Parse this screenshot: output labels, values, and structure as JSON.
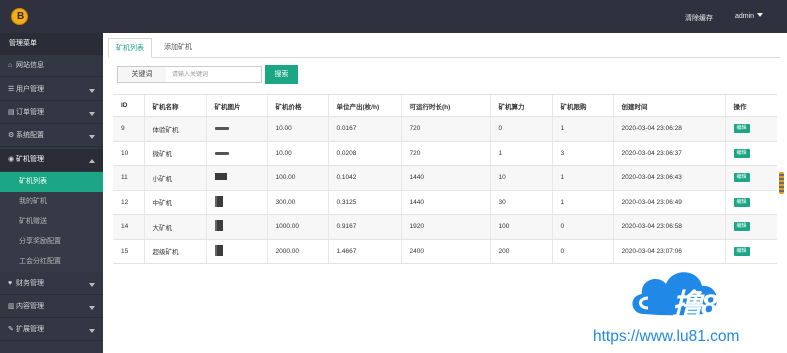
{
  "header": {
    "logo_letter": "B",
    "clear_cache": "清除缓存",
    "admin": "admin"
  },
  "sidebar": {
    "title": "管理菜单",
    "items": [
      {
        "icon": "home-icon",
        "glyph": "⌂",
        "label": "网站信息"
      },
      {
        "icon": "user-icon",
        "glyph": "☰",
        "label": "用户管理"
      },
      {
        "icon": "order-icon",
        "glyph": "▤",
        "label": "订单管理"
      },
      {
        "icon": "settings-icon",
        "glyph": "⚙",
        "label": "系统配置"
      },
      {
        "icon": "miner-icon",
        "glyph": "◉",
        "label": "矿机管理"
      },
      {
        "icon": "finance-icon",
        "glyph": "♥",
        "label": "财务管理"
      },
      {
        "icon": "content-icon",
        "glyph": "▥",
        "label": "内容管理"
      },
      {
        "icon": "extension-icon",
        "glyph": "✎",
        "label": "扩展管理"
      }
    ],
    "subitems": [
      {
        "label": "矿机列表"
      },
      {
        "label": "我的矿机"
      },
      {
        "label": "矿机赠送"
      },
      {
        "label": "分享奖励配置"
      },
      {
        "label": "工会分红配置"
      }
    ]
  },
  "tabs": [
    {
      "label": "矿机列表"
    },
    {
      "label": "添加矿机"
    }
  ],
  "search": {
    "label": "关键词",
    "placeholder": "请输入关键词",
    "button": "搜索"
  },
  "table": {
    "columns": [
      "ID",
      "矿机名称",
      "矿机图片",
      "矿机价格",
      "单位产出(枚/h)",
      "可运行时长(h)",
      "矿机算力",
      "矿机限购",
      "创建时间",
      "操作"
    ],
    "rows": [
      {
        "id": "9",
        "name": "体验矿机",
        "image": "flat",
        "price": "10.00",
        "output": "0.0167",
        "hours": "720",
        "power": "0",
        "limit": "1",
        "created": "2020-03-04 23:06:28",
        "action": "编辑"
      },
      {
        "id": "10",
        "name": "微矿机",
        "image": "flat",
        "price": "10.00",
        "output": "0.0208",
        "hours": "720",
        "power": "1",
        "limit": "3",
        "created": "2020-03-04 23:06:37",
        "action": "编辑"
      },
      {
        "id": "11",
        "name": "小矿机",
        "image": "box",
        "price": "100.00",
        "output": "0.1042",
        "hours": "1440",
        "power": "10",
        "limit": "1",
        "created": "2020-03-04 23:06:43",
        "action": "编辑"
      },
      {
        "id": "12",
        "name": "中矿机",
        "image": "tower",
        "price": "300.00",
        "output": "0.3125",
        "hours": "1440",
        "power": "30",
        "limit": "1",
        "created": "2020-03-04 23:06:49",
        "action": "编辑"
      },
      {
        "id": "14",
        "name": "大矿机",
        "image": "tower",
        "price": "1000.00",
        "output": "0.9167",
        "hours": "1920",
        "power": "100",
        "limit": "0",
        "created": "2020-03-04 23:06:58",
        "action": "编辑"
      },
      {
        "id": "15",
        "name": "超级矿机",
        "image": "tower",
        "price": "2000.00",
        "output": "1.4667",
        "hours": "2400",
        "power": "200",
        "limit": "0",
        "created": "2020-03-04 23:07:06",
        "action": "编辑"
      }
    ]
  },
  "watermark": {
    "logo_text": "撸81",
    "url": "https://www.lu81.com"
  },
  "colors": {
    "accent": "#1ba685",
    "topbar": "#2f323e",
    "sidebar": "#333744",
    "watermark_blue": "#2089e8"
  }
}
